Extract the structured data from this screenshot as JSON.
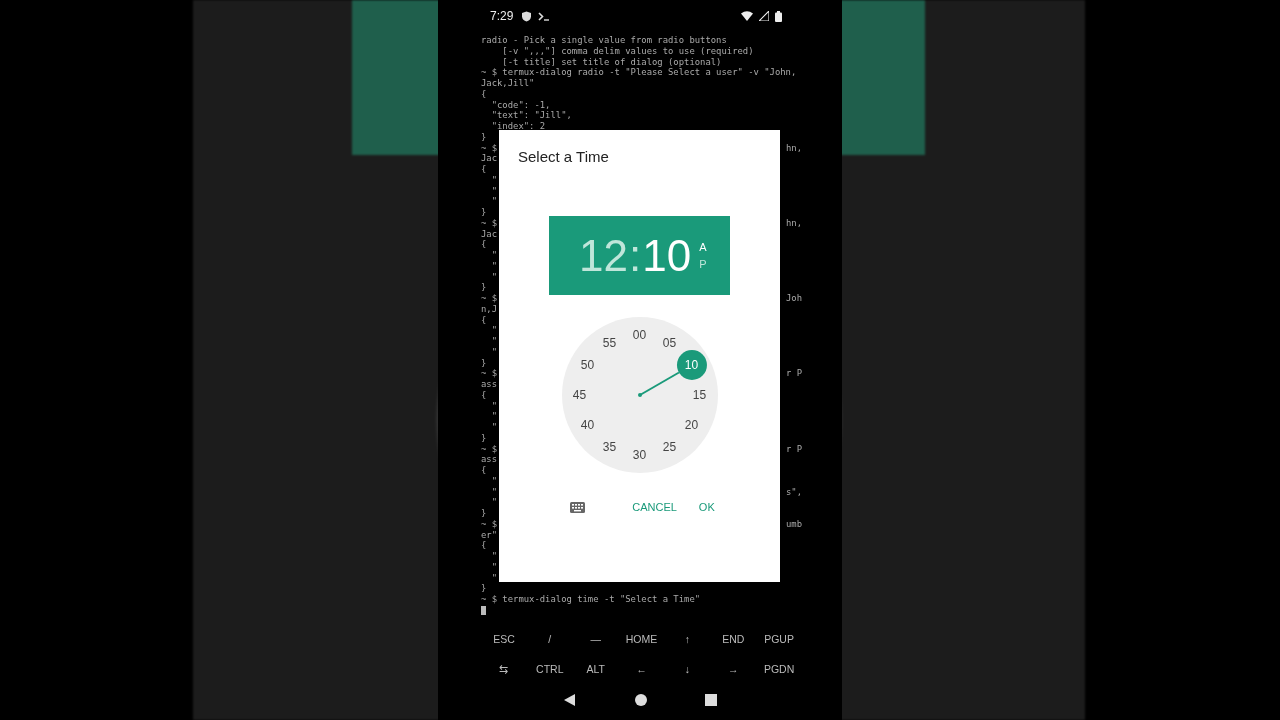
{
  "status_bar": {
    "time": "7:29"
  },
  "terminal": {
    "lines": [
      {
        "left": "radio - Pick a single value from radio buttons"
      },
      {
        "left": "    [-v \",,,\"] comma delim values to use (required)"
      },
      {
        "left": "    [-t title] set title of dialog (optional)"
      },
      {
        "left": "~ $ termux-dialog radio -t \"Please Select a user\" -v \"John,"
      },
      {
        "left": "Jack,Jill\""
      },
      {
        "left": "{"
      },
      {
        "left": "  \"code\": -1,"
      },
      {
        "left": "  \"text\": \"Jill\","
      },
      {
        "left": "  \"index\": 2"
      },
      {
        "left": "}"
      },
      {
        "left": "~ $",
        "right": "hn,"
      },
      {
        "left": "Jac"
      },
      {
        "left": "{"
      },
      {
        "left": "  \""
      },
      {
        "left": "  \""
      },
      {
        "left": "  \""
      },
      {
        "left": "}"
      },
      {
        "left": "~ $",
        "right": "hn,"
      },
      {
        "left": "Jac"
      },
      {
        "left": "{"
      },
      {
        "left": "  \""
      },
      {
        "left": "  \""
      },
      {
        "left": "  \""
      },
      {
        "left": "}"
      },
      {
        "left": "~ $",
        "right": "Joh"
      },
      {
        "left": "n,J"
      },
      {
        "left": "{"
      },
      {
        "left": "  \""
      },
      {
        "left": "  \""
      },
      {
        "left": "  \""
      },
      {
        "left": "}"
      },
      {
        "left": "~ $",
        "right": "r P"
      },
      {
        "left": "ass"
      },
      {
        "left": "{"
      },
      {
        "left": "  \""
      },
      {
        "left": "  \""
      },
      {
        "left": "  \""
      },
      {
        "left": "}"
      },
      {
        "left": "~ $",
        "right": "r P"
      },
      {
        "left": "ass"
      },
      {
        "left": "{"
      },
      {
        "left": "  \""
      },
      {
        "left": "  \"",
        "right": "s\","
      },
      {
        "left": "  \""
      },
      {
        "left": "}"
      },
      {
        "left": "~ $",
        "right": "umb"
      },
      {
        "left": "er\""
      },
      {
        "left": "{"
      },
      {
        "left": "  \""
      },
      {
        "left": "  \""
      },
      {
        "left": "  \""
      },
      {
        "left": "}"
      },
      {
        "left": "~ $ termux-dialog time -t \"Select a Time\""
      }
    ]
  },
  "dialog": {
    "title": "Select a Time",
    "header": {
      "hour": {
        "text": "12",
        "selected": false
      },
      "separator": ":",
      "minute": {
        "text": "10",
        "selected": true
      },
      "periods": [
        {
          "label": "A",
          "selected": true
        },
        {
          "label": "P",
          "selected": false
        }
      ]
    },
    "clock": {
      "minutes": [
        {
          "label": "00",
          "selected": false
        },
        {
          "label": "05",
          "selected": false
        },
        {
          "label": "10",
          "selected": true
        },
        {
          "label": "15",
          "selected": false
        },
        {
          "label": "20",
          "selected": false
        },
        {
          "label": "25",
          "selected": false
        },
        {
          "label": "30",
          "selected": false
        },
        {
          "label": "35",
          "selected": false
        },
        {
          "label": "40",
          "selected": false
        },
        {
          "label": "45",
          "selected": false
        },
        {
          "label": "50",
          "selected": false
        },
        {
          "label": "55",
          "selected": false
        }
      ]
    },
    "buttons": [
      "CANCEL",
      "OK"
    ]
  },
  "extra_keys": [
    [
      "ESC",
      "/",
      "―",
      "HOME",
      "↑",
      "END",
      "PGUP"
    ],
    [
      "⇆",
      "CTRL",
      "ALT",
      "←",
      "↓",
      "→",
      "PGDN"
    ]
  ]
}
